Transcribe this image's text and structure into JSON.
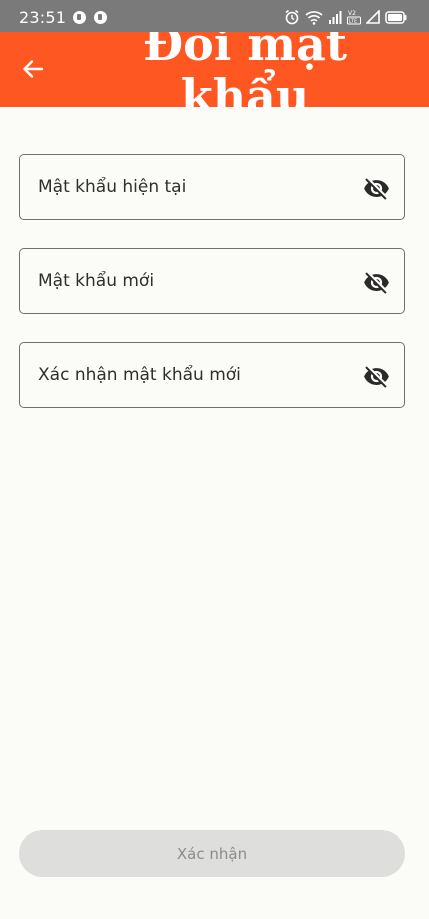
{
  "status_bar": {
    "time": "23:51",
    "network_label": "LTE"
  },
  "app_bar": {
    "title": "Đổi mật khẩu",
    "background_color": "#ff5722"
  },
  "form": {
    "fields": [
      {
        "placeholder": "Mật khẩu hiện tại",
        "value": "",
        "icon": "eye-off-icon"
      },
      {
        "placeholder": "Mật khẩu mới",
        "value": "",
        "icon": "eye-off-icon"
      },
      {
        "placeholder": "Xác nhận mật khẩu mới",
        "value": "",
        "icon": "eye-off-icon"
      }
    ]
  },
  "submit": {
    "label": "Xác nhận",
    "state": "disabled"
  }
}
